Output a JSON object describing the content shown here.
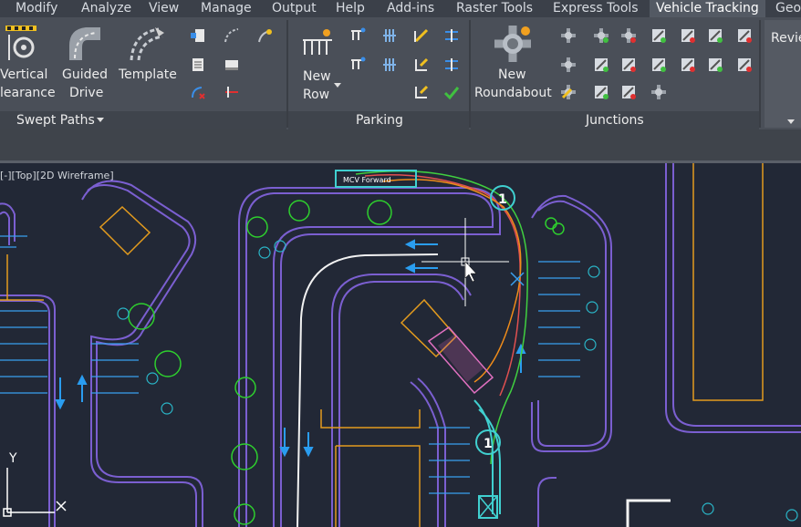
{
  "menu": {
    "tabs": [
      "Modify",
      "Analyze",
      "View",
      "Manage",
      "Output",
      "Help",
      "Add-ins",
      "Raster Tools",
      "Express Tools",
      "Vehicle Tracking",
      "Geo"
    ]
  },
  "ribbon": {
    "swept_paths": {
      "buttons": [
        {
          "line1": "Vertical",
          "line2": "learance"
        },
        {
          "line1": "Guided",
          "line2": "Drive"
        },
        {
          "line1": "Template",
          "line2": ""
        }
      ],
      "label": "Swept Paths"
    },
    "parking": {
      "new_row": {
        "line1": "New",
        "line2": "Row"
      },
      "label": "Parking"
    },
    "junctions": {
      "new_roundabout": {
        "line1": "New",
        "line2": "Roundabout"
      },
      "label": "Junctions"
    },
    "review_tab_text": "Revie"
  },
  "viewport": {
    "label": "[-][Top][2D Wireframe]",
    "markers": [
      "1",
      "1"
    ],
    "vehicle_tag": "MCV Forward",
    "ucs_y": "Y"
  },
  "colors": {
    "road": "#7b5fd1",
    "building": "#e39b1e",
    "tree": "#2ecf2e",
    "arrow": "#2a9df0",
    "vehicle_path": "#f08c1a",
    "path_green": "#40d040",
    "path_red": "#e05050"
  }
}
